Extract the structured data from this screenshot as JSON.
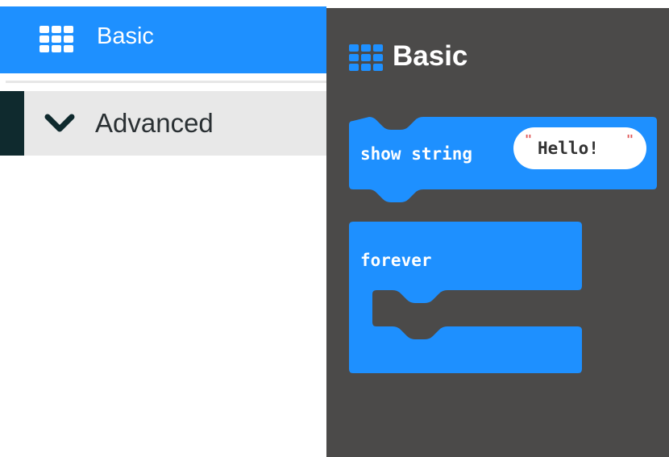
{
  "toolbox": {
    "basic": {
      "label": "Basic",
      "icon": "grid-icon",
      "color": "#1e90ff"
    },
    "advanced": {
      "label": "Advanced",
      "icon": "chevron-down-icon"
    }
  },
  "flyout": {
    "title": "Basic",
    "icon": "grid-icon",
    "background": "#4b4a49",
    "blocks": {
      "show_string": {
        "label": "show string",
        "value": "Hello!"
      },
      "forever": {
        "label": "forever"
      }
    }
  },
  "colors": {
    "block": "#1e90ff",
    "advanced_bar": "#0f2a2e",
    "advanced_bg": "#e8e8e8",
    "quote": "#e05a5a"
  }
}
